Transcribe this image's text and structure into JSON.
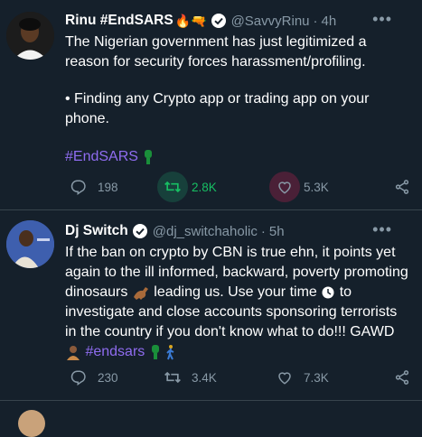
{
  "tweets": [
    {
      "name": "Rinu #EndSARS",
      "name_emojis": "🔥🔫",
      "handle": "@SavvyRinu",
      "time": "4h",
      "paragraphs": [
        "The Nigerian government has just legitimized a reason for security forces harassment/profiling.",
        "• Finding any Crypto app or trading app on your phone."
      ],
      "hashtag": "#EndSARS",
      "replies": "198",
      "retweets": "2.8K",
      "likes": "5.3K"
    },
    {
      "name": "Dj Switch",
      "handle": "@dj_switchaholic",
      "time": "5h",
      "text_a": "If the ban on crypto by CBN is true ehn, it points yet again to the ill informed, backward, poverty promoting dinosaurs ",
      "text_b": " leading us. Use your time ",
      "text_c": " to investigate and close accounts sponsoring terrorists in the country if you don't know what to do!!! GAWD ",
      "hashtag": "#endsars",
      "replies": "230",
      "retweets": "3.4K",
      "likes": "7.3K"
    }
  ],
  "icons": {
    "reply": "reply-icon",
    "retweet": "retweet-icon",
    "like": "heart-icon",
    "share": "share-icon",
    "verified": "verified-badge-icon",
    "more": "more-icon"
  },
  "colors": {
    "background": "#15202b",
    "secondary_text": "#8899a6",
    "hashtag": "#8f6cf0",
    "retweet_active": "#17bf63",
    "divider": "#38444d"
  }
}
